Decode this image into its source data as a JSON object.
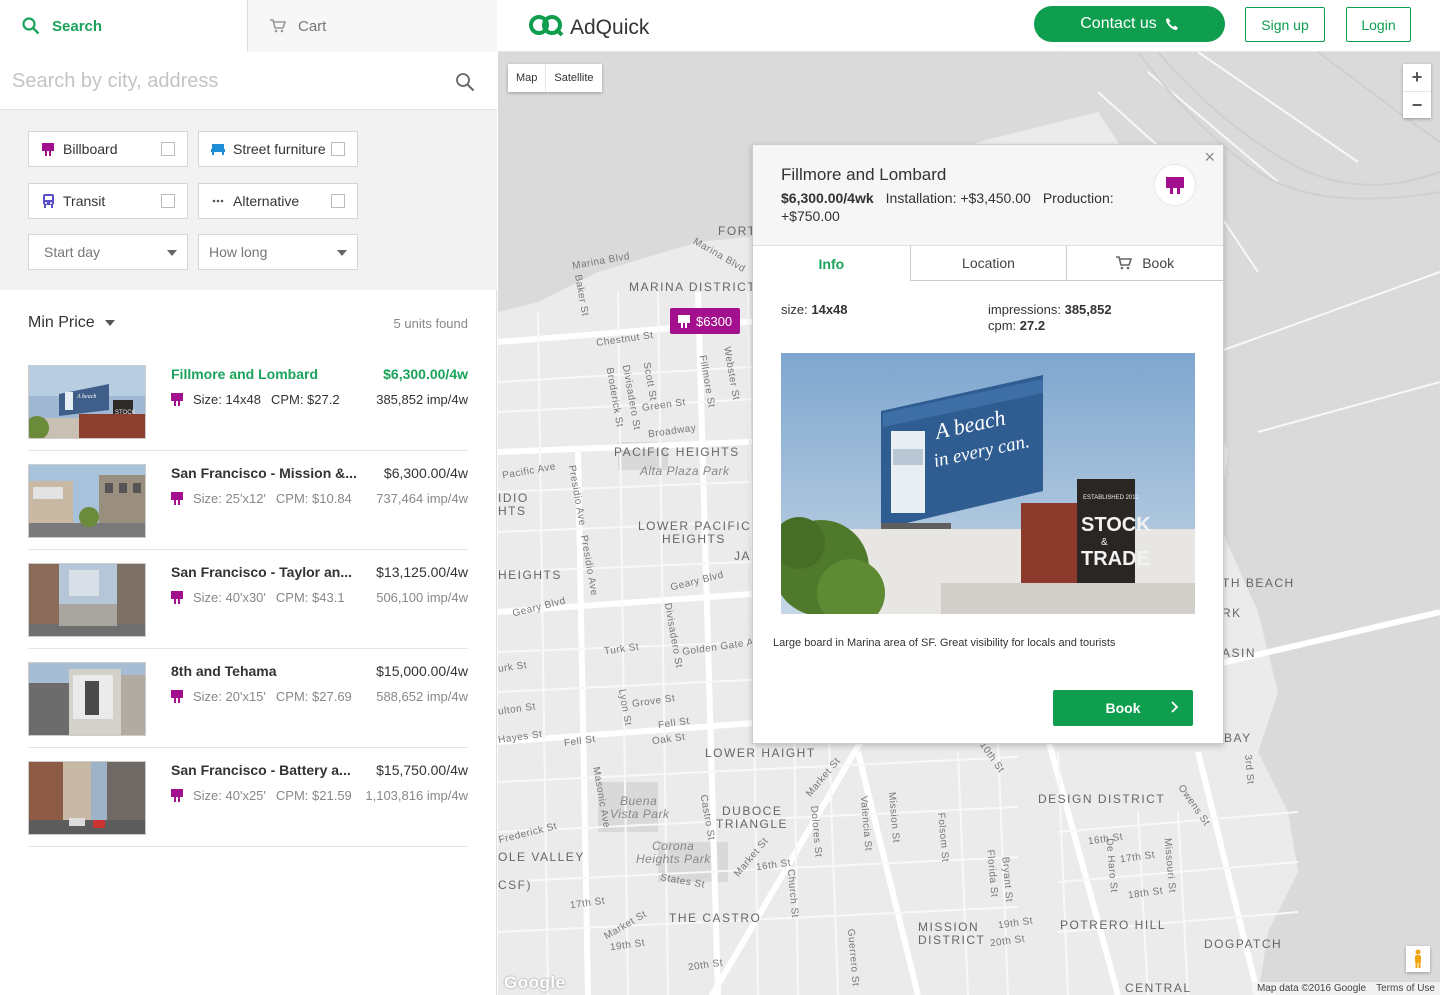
{
  "nav": {
    "search_tab": "Search",
    "cart_tab": "Cart"
  },
  "search": {
    "placeholder": "Search by city, address",
    "value": ""
  },
  "filters": {
    "billboard": "Billboard",
    "street_furniture": "Street furniture",
    "transit": "Transit",
    "alternative": "Alternative",
    "start_day": "Start day",
    "how_long": "How long"
  },
  "list": {
    "sort_label": "Min Price",
    "count_label": "5 units found",
    "items": [
      {
        "name": "Fillmore and Lombard",
        "price": "$6,300.00/4w",
        "size": "Size: 14x48",
        "cpm": "CPM: $27.2",
        "impressions": "385,852 imp/4w"
      },
      {
        "name": "San Francisco - Mission &...",
        "price": "$6,300.00/4w",
        "size": "Size: 25'x12'",
        "cpm": "CPM: $10.84",
        "impressions": "737,464 imp/4w"
      },
      {
        "name": "San Francisco - Taylor an...",
        "price": "$13,125.00/4w",
        "size": "Size: 40'x30'",
        "cpm": "CPM: $43.1",
        "impressions": "506,100 imp/4w"
      },
      {
        "name": "8th and Tehama",
        "price": "$15,000.00/4w",
        "size": "Size: 20'x15'",
        "cpm": "CPM: $27.69",
        "impressions": "588,652 imp/4w"
      },
      {
        "name": "San Francisco - Battery a...",
        "price": "$15,750.00/4w",
        "size": "Size: 40'x25'",
        "cpm": "CPM: $21.59",
        "impressions": "1,103,816 imp/4w"
      }
    ]
  },
  "header": {
    "brand": "AdQuick",
    "contact": "Contact us",
    "signup": "Sign up",
    "login": "Login"
  },
  "map": {
    "type_map": "Map",
    "type_satellite": "Satellite",
    "zoom_in": "+",
    "zoom_out": "−",
    "pin_price": "$6300",
    "google": "Google",
    "map_data": "Map data ©2016 Google",
    "terms": "Terms of Use",
    "labels": {
      "marina_district": "MARINA DISTRICT",
      "pacific_heights": "PACIFIC HEIGHTS",
      "alta_plaza": "Alta Plaza Park",
      "lower_pacific": "LOWER PACIFIC",
      "heights": "HEIGHTS",
      "lower_haight": "LOWER HAIGHT",
      "duboce": "DUBOCE",
      "triangle": "TRIANGLE",
      "the_castro": "THE CASTRO",
      "mission": "MISSION",
      "district": "DISTRICT",
      "potrero": "POTRERO HILL",
      "dogpatch": "DOGPATCH",
      "design_district": "DESIGN DISTRICT",
      "buena_vista": "Buena",
      "vista_park": "Vista Park",
      "corona": "Corona",
      "corona_heights": "Heights Park",
      "cole_valley": "OLE VALLEY",
      "heights_left": "HEIGHTS",
      "fort": "FORT",
      "bay": "BAY",
      "beach": "TH BEACH",
      "rk": "RK",
      "asin": "ASIN",
      "idio": "IDIO",
      "hts": "HTS",
      "csf": "CSF)",
      "ja": "JA",
      "central": "CENTRAL",
      "marina_blvd": "Marina Blvd",
      "marina_blvd2": "Marina Blvd",
      "chestnut": "Chestnut St",
      "fillmore_st": "Fillmore St",
      "webster_st": "Webster St",
      "scott_st": "Scott St",
      "divisadero_st": "Divisadero St",
      "broderick_st": "Broderick St",
      "baker_st": "Baker St",
      "green_st": "Green St",
      "broadway": "Broadway",
      "pacific_ave": "Pacific Ave",
      "presidio_ave": "Presidio Ave",
      "presidio_ave2": "Presidio Ave",
      "geary_blvd": "Geary Blvd",
      "geary_blvd2": "Geary Blvd",
      "divisadero_st2": "Divisadero St",
      "turk_st": "Turk St",
      "turk_st2": "urk St",
      "golden_gate": "Golden Gate A",
      "grove_st": "Grove St",
      "lyon_st": "Lyon St",
      "fulton_st": "ulton St",
      "hayes_st": "Hayes St",
      "fell_st": "Fell St",
      "fell_st2": "Fell St",
      "oak_st": "Oak St",
      "masonic_ave": "Masonic Ave",
      "castro_st": "Castro St",
      "market_st": "Market St",
      "market_st2": "Market St",
      "market_st3": "Market St",
      "dolores_st": "Dolores St",
      "valencia_st": "Valencia St",
      "mission_st": "Mission St",
      "folsom_st": "Folsom St",
      "st10": "10th St",
      "st16": "16th St",
      "st16b": "16th St",
      "st17": "17th St",
      "st17b": "17th St",
      "st18": "18th St",
      "st19": "19th St",
      "st19b": "19th St",
      "st20": "20th St",
      "st20b": "20th St",
      "church_st": "Church St",
      "guerrero_st": "Guerrero St",
      "frederick_st": "Frederick St",
      "states_st": "States St",
      "bryant_st": "Bryant St",
      "florida_st": "Florida St",
      "de_haro": "De Haro St",
      "missouri_st": "Missouri St",
      "owens_st": "Owens St",
      "third_st": "3rd St",
      "st_rk": "St"
    }
  },
  "popup": {
    "close": "×",
    "title": "Fillmore and Lombard",
    "price": "$6,300.00/4wk",
    "installation": "Installation: +$3,450.00",
    "production_label": "Production:",
    "production_value": "+$750.00",
    "tab_info": "Info",
    "tab_location": "Location",
    "tab_book": "Book",
    "size_label": "size:",
    "size_value": "14x48",
    "impressions_label": "impressions:",
    "impressions_value": "385,852",
    "cpm_label": "cpm:",
    "cpm_value": "27.2",
    "billboard_text_1": "A beach",
    "billboard_text_2": "in every can.",
    "sign_text_1": "ESTABLISHED 2012",
    "sign_text_2": "STOCK",
    "sign_text_3": "&",
    "sign_text_4": "TRADE",
    "description": "Large board in Marina area of SF. Great visibility for locals and tourists",
    "book_button": "Book"
  },
  "colors": {
    "brand_green": "#0e9e4e",
    "accent_purple": "#a3108d",
    "transit_blue": "#5a4fc6",
    "furniture_blue": "#1e8fd6"
  }
}
